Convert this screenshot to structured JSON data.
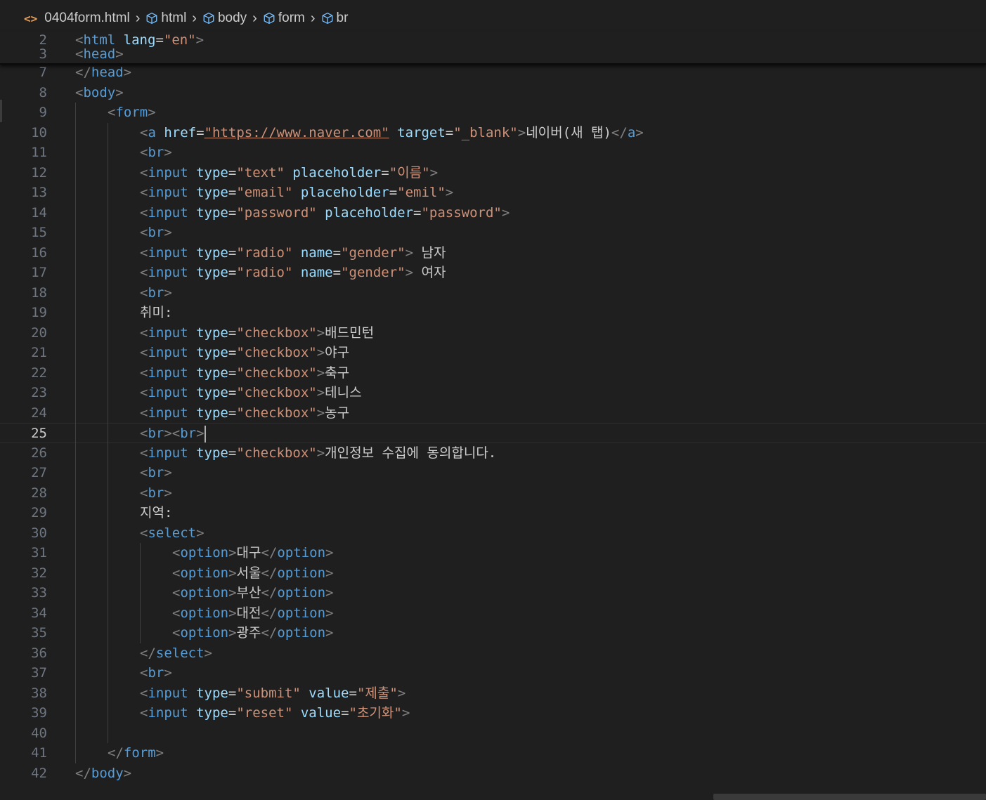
{
  "breadcrumb": {
    "file_icon": "<>",
    "file": "0404form.html",
    "items": [
      "html",
      "body",
      "form",
      "br"
    ]
  },
  "sticky_lines": [
    {
      "num": "2",
      "tokens": [
        [
          "t",
          "<"
        ],
        [
          "tag",
          "html"
        ],
        [
          "txt",
          " "
        ],
        [
          "attr",
          "lang"
        ],
        [
          "txt",
          "="
        ],
        [
          "str",
          "\"en\""
        ],
        [
          "t",
          ">"
        ]
      ]
    },
    {
      "num": "3",
      "tokens": [
        [
          "t",
          "<"
        ],
        [
          "tag",
          "head"
        ],
        [
          "t",
          ">"
        ]
      ]
    }
  ],
  "active_line": "25",
  "lines": [
    {
      "num": "7",
      "indent": 0,
      "tokens": [
        [
          "t",
          "</"
        ],
        [
          "tag",
          "head"
        ],
        [
          "t",
          ">"
        ]
      ]
    },
    {
      "num": "8",
      "indent": 0,
      "tokens": [
        [
          "t",
          "<"
        ],
        [
          "tag",
          "body"
        ],
        [
          "t",
          ">"
        ]
      ]
    },
    {
      "num": "9",
      "indent": 1,
      "tokens": [
        [
          "t",
          "<"
        ],
        [
          "tag",
          "form"
        ],
        [
          "t",
          ">"
        ]
      ]
    },
    {
      "num": "10",
      "indent": 2,
      "tokens": [
        [
          "t",
          "<"
        ],
        [
          "tag",
          "a"
        ],
        [
          "txt",
          " "
        ],
        [
          "attr",
          "href"
        ],
        [
          "txt",
          "="
        ],
        [
          "link",
          "\"https://www.naver.com\""
        ],
        [
          "txt",
          " "
        ],
        [
          "attr",
          "target"
        ],
        [
          "txt",
          "="
        ],
        [
          "str",
          "\"_blank\""
        ],
        [
          "t",
          ">"
        ],
        [
          "txt",
          "네이버(새 탭)"
        ],
        [
          "t",
          "</"
        ],
        [
          "tag",
          "a"
        ],
        [
          "t",
          ">"
        ]
      ]
    },
    {
      "num": "11",
      "indent": 2,
      "tokens": [
        [
          "t",
          "<"
        ],
        [
          "tag",
          "br"
        ],
        [
          "t",
          ">"
        ]
      ]
    },
    {
      "num": "12",
      "indent": 2,
      "tokens": [
        [
          "t",
          "<"
        ],
        [
          "tag",
          "input"
        ],
        [
          "txt",
          " "
        ],
        [
          "attr",
          "type"
        ],
        [
          "txt",
          "="
        ],
        [
          "str",
          "\"text\""
        ],
        [
          "txt",
          " "
        ],
        [
          "attr",
          "placeholder"
        ],
        [
          "txt",
          "="
        ],
        [
          "str",
          "\"이름\""
        ],
        [
          "t",
          ">"
        ]
      ]
    },
    {
      "num": "13",
      "indent": 2,
      "tokens": [
        [
          "t",
          "<"
        ],
        [
          "tag",
          "input"
        ],
        [
          "txt",
          " "
        ],
        [
          "attr",
          "type"
        ],
        [
          "txt",
          "="
        ],
        [
          "str",
          "\"email\""
        ],
        [
          "txt",
          " "
        ],
        [
          "attr",
          "placeholder"
        ],
        [
          "txt",
          "="
        ],
        [
          "str",
          "\"emil\""
        ],
        [
          "t",
          ">"
        ]
      ]
    },
    {
      "num": "14",
      "indent": 2,
      "tokens": [
        [
          "t",
          "<"
        ],
        [
          "tag",
          "input"
        ],
        [
          "txt",
          " "
        ],
        [
          "attr",
          "type"
        ],
        [
          "txt",
          "="
        ],
        [
          "str",
          "\"password\""
        ],
        [
          "txt",
          " "
        ],
        [
          "attr",
          "placeholder"
        ],
        [
          "txt",
          "="
        ],
        [
          "str",
          "\"password\""
        ],
        [
          "t",
          ">"
        ]
      ]
    },
    {
      "num": "15",
      "indent": 2,
      "tokens": [
        [
          "t",
          "<"
        ],
        [
          "tag",
          "br"
        ],
        [
          "t",
          ">"
        ]
      ]
    },
    {
      "num": "16",
      "indent": 2,
      "tokens": [
        [
          "t",
          "<"
        ],
        [
          "tag",
          "input"
        ],
        [
          "txt",
          " "
        ],
        [
          "attr",
          "type"
        ],
        [
          "txt",
          "="
        ],
        [
          "str",
          "\"radio\""
        ],
        [
          "txt",
          " "
        ],
        [
          "attr",
          "name"
        ],
        [
          "txt",
          "="
        ],
        [
          "str",
          "\"gender\""
        ],
        [
          "t",
          ">"
        ],
        [
          "txt",
          " 남자"
        ]
      ]
    },
    {
      "num": "17",
      "indent": 2,
      "tokens": [
        [
          "t",
          "<"
        ],
        [
          "tag",
          "input"
        ],
        [
          "txt",
          " "
        ],
        [
          "attr",
          "type"
        ],
        [
          "txt",
          "="
        ],
        [
          "str",
          "\"radio\""
        ],
        [
          "txt",
          " "
        ],
        [
          "attr",
          "name"
        ],
        [
          "txt",
          "="
        ],
        [
          "str",
          "\"gender\""
        ],
        [
          "t",
          ">"
        ],
        [
          "txt",
          " 여자"
        ]
      ]
    },
    {
      "num": "18",
      "indent": 2,
      "tokens": [
        [
          "t",
          "<"
        ],
        [
          "tag",
          "br"
        ],
        [
          "t",
          ">"
        ]
      ]
    },
    {
      "num": "19",
      "indent": 2,
      "tokens": [
        [
          "txt",
          "취미:"
        ]
      ]
    },
    {
      "num": "20",
      "indent": 2,
      "tokens": [
        [
          "t",
          "<"
        ],
        [
          "tag",
          "input"
        ],
        [
          "txt",
          " "
        ],
        [
          "attr",
          "type"
        ],
        [
          "txt",
          "="
        ],
        [
          "str",
          "\"checkbox\""
        ],
        [
          "t",
          ">"
        ],
        [
          "txt",
          "배드민턴"
        ]
      ]
    },
    {
      "num": "21",
      "indent": 2,
      "tokens": [
        [
          "t",
          "<"
        ],
        [
          "tag",
          "input"
        ],
        [
          "txt",
          " "
        ],
        [
          "attr",
          "type"
        ],
        [
          "txt",
          "="
        ],
        [
          "str",
          "\"checkbox\""
        ],
        [
          "t",
          ">"
        ],
        [
          "txt",
          "야구"
        ]
      ]
    },
    {
      "num": "22",
      "indent": 2,
      "tokens": [
        [
          "t",
          "<"
        ],
        [
          "tag",
          "input"
        ],
        [
          "txt",
          " "
        ],
        [
          "attr",
          "type"
        ],
        [
          "txt",
          "="
        ],
        [
          "str",
          "\"checkbox\""
        ],
        [
          "t",
          ">"
        ],
        [
          "txt",
          "축구"
        ]
      ]
    },
    {
      "num": "23",
      "indent": 2,
      "tokens": [
        [
          "t",
          "<"
        ],
        [
          "tag",
          "input"
        ],
        [
          "txt",
          " "
        ],
        [
          "attr",
          "type"
        ],
        [
          "txt",
          "="
        ],
        [
          "str",
          "\"checkbox\""
        ],
        [
          "t",
          ">"
        ],
        [
          "txt",
          "테니스"
        ]
      ]
    },
    {
      "num": "24",
      "indent": 2,
      "tokens": [
        [
          "t",
          "<"
        ],
        [
          "tag",
          "input"
        ],
        [
          "txt",
          " "
        ],
        [
          "attr",
          "type"
        ],
        [
          "txt",
          "="
        ],
        [
          "str",
          "\"checkbox\""
        ],
        [
          "t",
          ">"
        ],
        [
          "txt",
          "농구"
        ]
      ]
    },
    {
      "num": "25",
      "indent": 2,
      "tokens": [
        [
          "t",
          "<"
        ],
        [
          "tag",
          "br"
        ],
        [
          "t",
          "><"
        ],
        [
          "tag",
          "br"
        ],
        [
          "t",
          ">"
        ]
      ]
    },
    {
      "num": "26",
      "indent": 2,
      "tokens": [
        [
          "t",
          "<"
        ],
        [
          "tag",
          "input"
        ],
        [
          "txt",
          " "
        ],
        [
          "attr",
          "type"
        ],
        [
          "txt",
          "="
        ],
        [
          "str",
          "\"checkbox\""
        ],
        [
          "t",
          ">"
        ],
        [
          "txt",
          "개인정보 수집에 동의합니다."
        ]
      ]
    },
    {
      "num": "27",
      "indent": 2,
      "tokens": [
        [
          "t",
          "<"
        ],
        [
          "tag",
          "br"
        ],
        [
          "t",
          ">"
        ]
      ]
    },
    {
      "num": "28",
      "indent": 2,
      "tokens": [
        [
          "t",
          "<"
        ],
        [
          "tag",
          "br"
        ],
        [
          "t",
          ">"
        ]
      ]
    },
    {
      "num": "29",
      "indent": 2,
      "tokens": [
        [
          "txt",
          "지역:"
        ]
      ]
    },
    {
      "num": "30",
      "indent": 2,
      "tokens": [
        [
          "t",
          "<"
        ],
        [
          "tag",
          "select"
        ],
        [
          "t",
          ">"
        ]
      ]
    },
    {
      "num": "31",
      "indent": 3,
      "tokens": [
        [
          "t",
          "<"
        ],
        [
          "tag",
          "option"
        ],
        [
          "t",
          ">"
        ],
        [
          "txt",
          "대구"
        ],
        [
          "t",
          "</"
        ],
        [
          "tag",
          "option"
        ],
        [
          "t",
          ">"
        ]
      ]
    },
    {
      "num": "32",
      "indent": 3,
      "tokens": [
        [
          "t",
          "<"
        ],
        [
          "tag",
          "option"
        ],
        [
          "t",
          ">"
        ],
        [
          "txt",
          "서울"
        ],
        [
          "t",
          "</"
        ],
        [
          "tag",
          "option"
        ],
        [
          "t",
          ">"
        ]
      ]
    },
    {
      "num": "33",
      "indent": 3,
      "tokens": [
        [
          "t",
          "<"
        ],
        [
          "tag",
          "option"
        ],
        [
          "t",
          ">"
        ],
        [
          "txt",
          "부산"
        ],
        [
          "t",
          "</"
        ],
        [
          "tag",
          "option"
        ],
        [
          "t",
          ">"
        ]
      ]
    },
    {
      "num": "34",
      "indent": 3,
      "tokens": [
        [
          "t",
          "<"
        ],
        [
          "tag",
          "option"
        ],
        [
          "t",
          ">"
        ],
        [
          "txt",
          "대전"
        ],
        [
          "t",
          "</"
        ],
        [
          "tag",
          "option"
        ],
        [
          "t",
          ">"
        ]
      ]
    },
    {
      "num": "35",
      "indent": 3,
      "tokens": [
        [
          "t",
          "<"
        ],
        [
          "tag",
          "option"
        ],
        [
          "t",
          ">"
        ],
        [
          "txt",
          "광주"
        ],
        [
          "t",
          "</"
        ],
        [
          "tag",
          "option"
        ],
        [
          "t",
          ">"
        ]
      ]
    },
    {
      "num": "36",
      "indent": 2,
      "tokens": [
        [
          "t",
          "</"
        ],
        [
          "tag",
          "select"
        ],
        [
          "t",
          ">"
        ]
      ]
    },
    {
      "num": "37",
      "indent": 2,
      "tokens": [
        [
          "t",
          "<"
        ],
        [
          "tag",
          "br"
        ],
        [
          "t",
          ">"
        ]
      ]
    },
    {
      "num": "38",
      "indent": 2,
      "tokens": [
        [
          "t",
          "<"
        ],
        [
          "tag",
          "input"
        ],
        [
          "txt",
          " "
        ],
        [
          "attr",
          "type"
        ],
        [
          "txt",
          "="
        ],
        [
          "str",
          "\"submit\""
        ],
        [
          "txt",
          " "
        ],
        [
          "attr",
          "value"
        ],
        [
          "txt",
          "="
        ],
        [
          "str",
          "\"제출\""
        ],
        [
          "t",
          ">"
        ]
      ]
    },
    {
      "num": "39",
      "indent": 2,
      "tokens": [
        [
          "t",
          "<"
        ],
        [
          "tag",
          "input"
        ],
        [
          "txt",
          " "
        ],
        [
          "attr",
          "type"
        ],
        [
          "txt",
          "="
        ],
        [
          "str",
          "\"reset\""
        ],
        [
          "txt",
          " "
        ],
        [
          "attr",
          "value"
        ],
        [
          "txt",
          "="
        ],
        [
          "str",
          "\"초기화\""
        ],
        [
          "t",
          ">"
        ]
      ]
    },
    {
      "num": "40",
      "indent": 2,
      "tokens": []
    },
    {
      "num": "41",
      "indent": 1,
      "tokens": [
        [
          "t",
          "</"
        ],
        [
          "tag",
          "form"
        ],
        [
          "t",
          ">"
        ]
      ]
    },
    {
      "num": "42",
      "indent": 0,
      "tokens": [
        [
          "t",
          "</"
        ],
        [
          "tag",
          "body"
        ],
        [
          "t",
          ">"
        ]
      ]
    }
  ],
  "colors": {
    "background": "#1f1f1f",
    "bracket": "#808080",
    "tag": "#569cd6",
    "attribute": "#9cdcfe",
    "string": "#ce9178",
    "text": "#cccccc",
    "line_number": "#6e7681"
  },
  "icons": {
    "file": "html-file-icon",
    "element": "cube-icon",
    "separator": "chevron-right-icon"
  }
}
